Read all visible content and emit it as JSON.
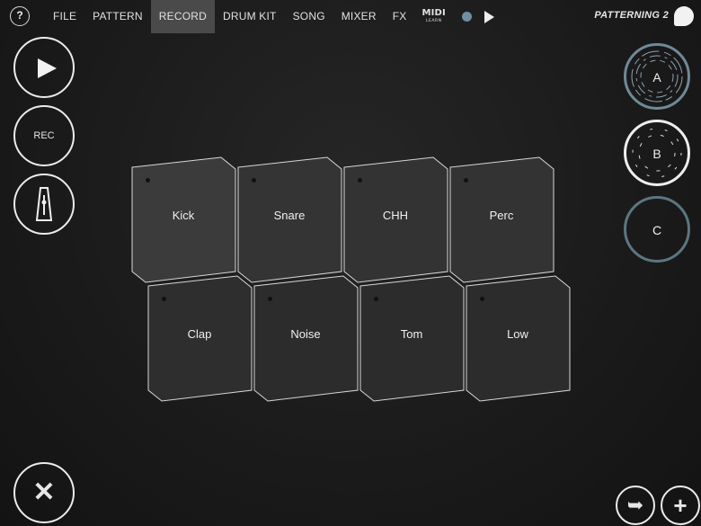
{
  "header": {
    "help_label": "?",
    "menu": [
      "FILE",
      "PATTERN",
      "RECORD",
      "DRUM KIT",
      "SONG",
      "MIXER",
      "FX"
    ],
    "active_menu": "RECORD",
    "midi_label": "MIDI",
    "midi_sub": "LEARN",
    "app_name": "PATTERNING 2"
  },
  "transport": {
    "rec_label": "REC"
  },
  "patterns": [
    "A",
    "B",
    "C"
  ],
  "pads": {
    "row1": [
      "Kick",
      "Snare",
      "CHH",
      "Perc"
    ],
    "row2": [
      "Clap",
      "Noise",
      "Tom",
      "Low"
    ]
  },
  "colors": {
    "pad_fill": "#303030",
    "pad_border": "#d8d8d8",
    "accent": "#6f8fa3",
    "active_menu_bg": "#4a4a4a"
  },
  "icons": [
    "help-icon",
    "midi-learn-icon",
    "status-dot",
    "play-icon",
    "metronome-icon",
    "close-icon",
    "arrow-right-icon",
    "plus-icon"
  ]
}
